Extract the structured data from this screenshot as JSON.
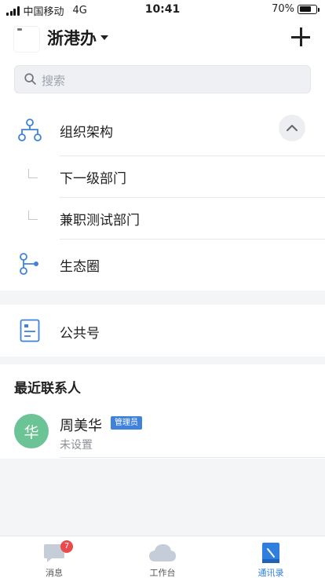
{
  "status_bar": {
    "carrier": "中国移动",
    "network": "4G",
    "time": "10:41",
    "battery": "70%",
    "battery_level": 0.7
  },
  "header": {
    "org_name": "浙港办"
  },
  "search": {
    "placeholder": "搜索"
  },
  "org_section": {
    "items": [
      {
        "label": "组织架构",
        "icon": "org-structure-icon"
      },
      {
        "label": "下一级部门"
      },
      {
        "label": "兼职测试部门"
      },
      {
        "label": "生态圈",
        "icon": "ecosystem-icon"
      }
    ]
  },
  "public_section": {
    "label": "公共号",
    "icon": "public-account-icon"
  },
  "recent_contacts": {
    "title": "最近联系人",
    "contacts": [
      {
        "avatar_text": "华",
        "name": "周美华",
        "badge": "管理员",
        "status": "未设置",
        "avatar_color": "#6cc496"
      }
    ]
  },
  "tab_bar": {
    "tabs": [
      {
        "label": "消息",
        "badge": "7",
        "icon": "message-icon"
      },
      {
        "label": "工作台",
        "icon": "cloud-icon"
      },
      {
        "label": "通讯录",
        "icon": "contacts-book-icon",
        "active": true
      }
    ]
  },
  "colors": {
    "accent": "#2f7fe0",
    "badge_red": "#e94b4b",
    "avatar_green": "#6cc496"
  }
}
